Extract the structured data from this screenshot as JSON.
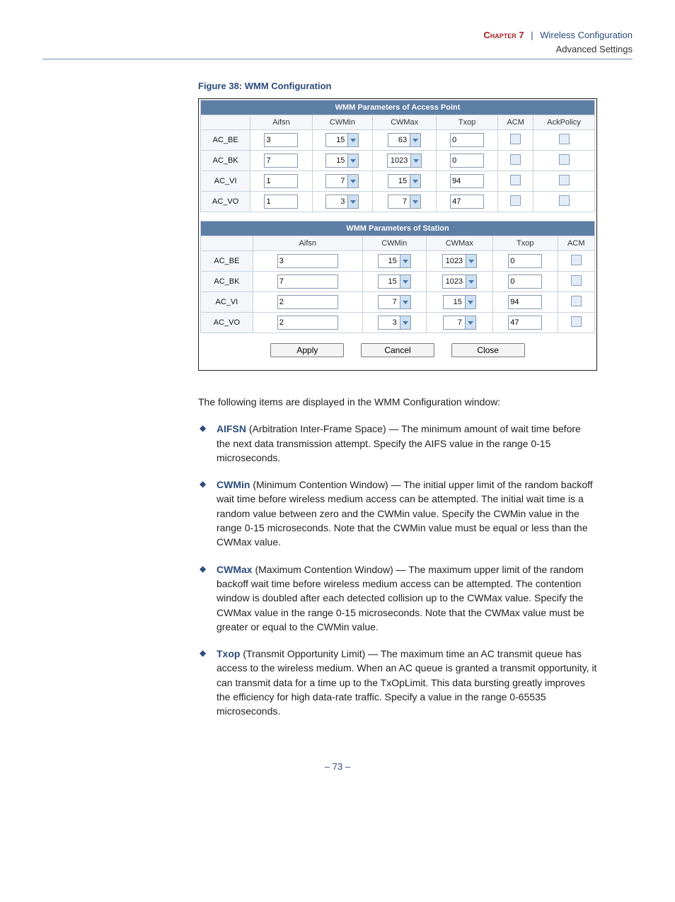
{
  "header": {
    "chapter_label": "Chapter 7",
    "separator": "|",
    "chapter_title": "Wireless Configuration",
    "subheader": "Advanced Settings"
  },
  "figure": {
    "title": "Figure 38:  WMM Configuration"
  },
  "ap_table": {
    "title": "WMM Parameters of Access Point",
    "cols": {
      "aifsn": "Aifsn",
      "cwmin": "CWMin",
      "cwmax": "CWMax",
      "txop": "Txop",
      "acm": "ACM",
      "ackpolicy": "AckPolicy"
    },
    "rows": [
      {
        "label": "AC_BE",
        "aifsn": "3",
        "cwmin": "15",
        "cwmax": "63",
        "txop": "0"
      },
      {
        "label": "AC_BK",
        "aifsn": "7",
        "cwmin": "15",
        "cwmax": "1023",
        "txop": "0"
      },
      {
        "label": "AC_VI",
        "aifsn": "1",
        "cwmin": "7",
        "cwmax": "15",
        "txop": "94"
      },
      {
        "label": "AC_VO",
        "aifsn": "1",
        "cwmin": "3",
        "cwmax": "7",
        "txop": "47"
      }
    ]
  },
  "sta_table": {
    "title": "WMM Parameters of Station",
    "cols": {
      "aifsn": "Aifsn",
      "cwmin": "CWMin",
      "cwmax": "CWMax",
      "txop": "Txop",
      "acm": "ACM"
    },
    "rows": [
      {
        "label": "AC_BE",
        "aifsn": "3",
        "cwmin": "15",
        "cwmax": "1023",
        "txop": "0"
      },
      {
        "label": "AC_BK",
        "aifsn": "7",
        "cwmin": "15",
        "cwmax": "1023",
        "txop": "0"
      },
      {
        "label": "AC_VI",
        "aifsn": "2",
        "cwmin": "7",
        "cwmax": "15",
        "txop": "94"
      },
      {
        "label": "AC_VO",
        "aifsn": "2",
        "cwmin": "3",
        "cwmax": "7",
        "txop": "47"
      }
    ]
  },
  "buttons": {
    "apply": "Apply",
    "cancel": "Cancel",
    "close": "Close"
  },
  "body": {
    "intro": "The following items are displayed in the WMM Configuration window:",
    "items": [
      {
        "term": "AIFSN",
        "desc": " (Arbitration Inter-Frame Space) — The minimum amount of wait time before the next data transmission attempt. Specify the AIFS value in the range 0-15 microseconds."
      },
      {
        "term": "CWMin",
        "desc": " (Minimum Contention Window) — The initial upper limit of the random backoff wait time before wireless medium access can be attempted. The initial wait time is a random value between zero and the CWMin value. Specify the CWMin value in the range 0-15 microseconds. Note that the CWMin value must be equal or less than the CWMax value."
      },
      {
        "term": "CWMax",
        "desc": " (Maximum Contention Window) — The maximum upper limit of the random backoff wait time before wireless medium access can be attempted. The contention window is doubled after each detected collision up to the CWMax value. Specify the CWMax value in the range 0-15 microseconds. Note that the CWMax value must be greater or equal to the CWMin value."
      },
      {
        "term": "Txop",
        "desc": " (Transmit Opportunity Limit) — The maximum time an AC transmit queue has access to the wireless medium. When an AC queue is granted a transmit opportunity, it can transmit data for a time up to the TxOpLimit. This data bursting greatly improves the efficiency for high data-rate traffic. Specify a value in the range 0-65535 microseconds."
      }
    ]
  },
  "pagenum": "– 73 –"
}
